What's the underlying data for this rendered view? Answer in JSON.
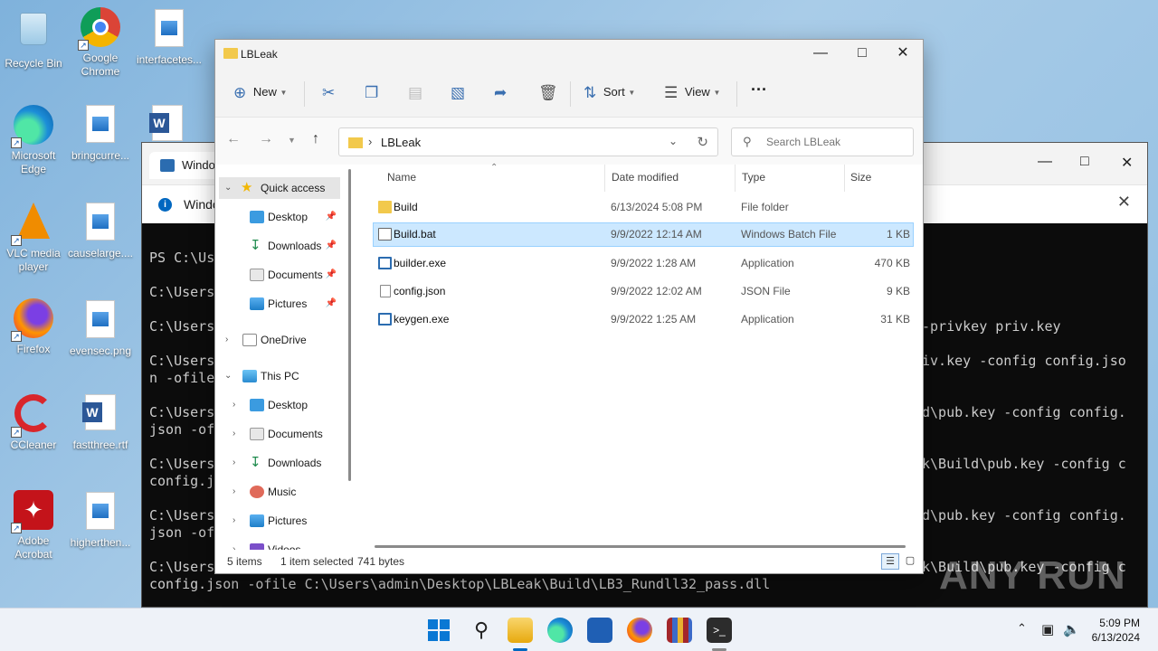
{
  "desktop": {
    "icons": [
      {
        "label": "Recycle Bin",
        "icon": "recycle-bin-icon"
      },
      {
        "label": "Google Chrome",
        "icon": "chrome-icon"
      },
      {
        "label": "interfacetes...",
        "icon": "image-file-icon"
      },
      {
        "label": "Microsoft Edge",
        "icon": "edge-icon"
      },
      {
        "label": "bringcurre...",
        "icon": "image-file-icon"
      },
      {
        "label": "",
        "icon": "word-document-icon"
      },
      {
        "label": "VLC media player",
        "icon": "vlc-icon"
      },
      {
        "label": "causelarge....",
        "icon": "image-file-icon"
      },
      {
        "label": "Firefox",
        "icon": "firefox-icon"
      },
      {
        "label": "evensec.png",
        "icon": "image-file-icon"
      },
      {
        "label": "CCleaner",
        "icon": "ccleaner-icon"
      },
      {
        "label": "fastthree.rtf",
        "icon": "word-document-icon"
      },
      {
        "label": "Adobe Acrobat",
        "icon": "acrobat-icon"
      },
      {
        "label": "higherthen...",
        "icon": "image-file-icon"
      }
    ]
  },
  "terminal": {
    "tab_title": "Windo",
    "info_text": "Windo",
    "lines": [
      "PS C:\\Us",
      "",
      "C:\\Users",
      "",
      "C:\\Users",
      "",
      "C:\\Users",
      "n -ofile",
      "",
      "C:\\Users",
      "json -of",
      "",
      "C:\\Users",
      "config.js",
      "",
      "C:\\Users",
      "json -of",
      "",
      "C:\\Users",
      "config.json -ofile C:\\Users\\admin\\Desktop\\LBLeak\\Build\\LB3_Rundll32_pass.dll"
    ],
    "right_lines": [
      "-privkey priv.key",
      "",
      "iv.key -config config.jso",
      "",
      "",
      "d\\pub.key -config config.",
      "",
      "",
      "k\\Build\\pub.key -config c",
      "",
      "",
      "d\\pub.key -config config.",
      "",
      "",
      "k\\Build\\pub.key -config c"
    ]
  },
  "explorer": {
    "title": "LBLeak",
    "toolbar": {
      "new_label": "New",
      "sort_label": "Sort",
      "view_label": "View",
      "more_label": "···"
    },
    "address": {
      "path": "LBLeak"
    },
    "search": {
      "placeholder": "Search LBLeak"
    },
    "nav": {
      "quick_access": "Quick access",
      "quick_items": [
        "Desktop",
        "Downloads",
        "Documents",
        "Pictures"
      ],
      "onedrive": "OneDrive",
      "this_pc": "This PC",
      "pc_items": [
        "Desktop",
        "Documents",
        "Downloads",
        "Music",
        "Pictures",
        "Videos"
      ]
    },
    "columns": {
      "name": "Name",
      "date": "Date modified",
      "type": "Type",
      "size": "Size"
    },
    "files": [
      {
        "name": "Build",
        "date": "6/13/2024 5:08 PM",
        "type": "File folder",
        "size": "",
        "icon": "folder-icon"
      },
      {
        "name": "Build.bat",
        "date": "9/9/2022 12:14 AM",
        "type": "Windows Batch File",
        "size": "1 KB",
        "icon": "batch-file-icon"
      },
      {
        "name": "builder.exe",
        "date": "9/9/2022 1:28 AM",
        "type": "Application",
        "size": "470 KB",
        "icon": "application-icon"
      },
      {
        "name": "config.json",
        "date": "9/9/2022 12:02 AM",
        "type": "JSON File",
        "size": "9 KB",
        "icon": "json-file-icon"
      },
      {
        "name": "keygen.exe",
        "date": "9/9/2022 1:25 AM",
        "type": "Application",
        "size": "31 KB",
        "icon": "application-icon"
      }
    ],
    "status": {
      "items": "5 items",
      "selected": "1 item selected",
      "bytes": "741 bytes"
    }
  },
  "taskbar": {
    "time": "5:09 PM",
    "date": "6/13/2024"
  },
  "watermark": "ANY RUN",
  "colors": {
    "accent": "#0067c0",
    "selection": "#cce8ff",
    "folder": "#f2c94c"
  }
}
